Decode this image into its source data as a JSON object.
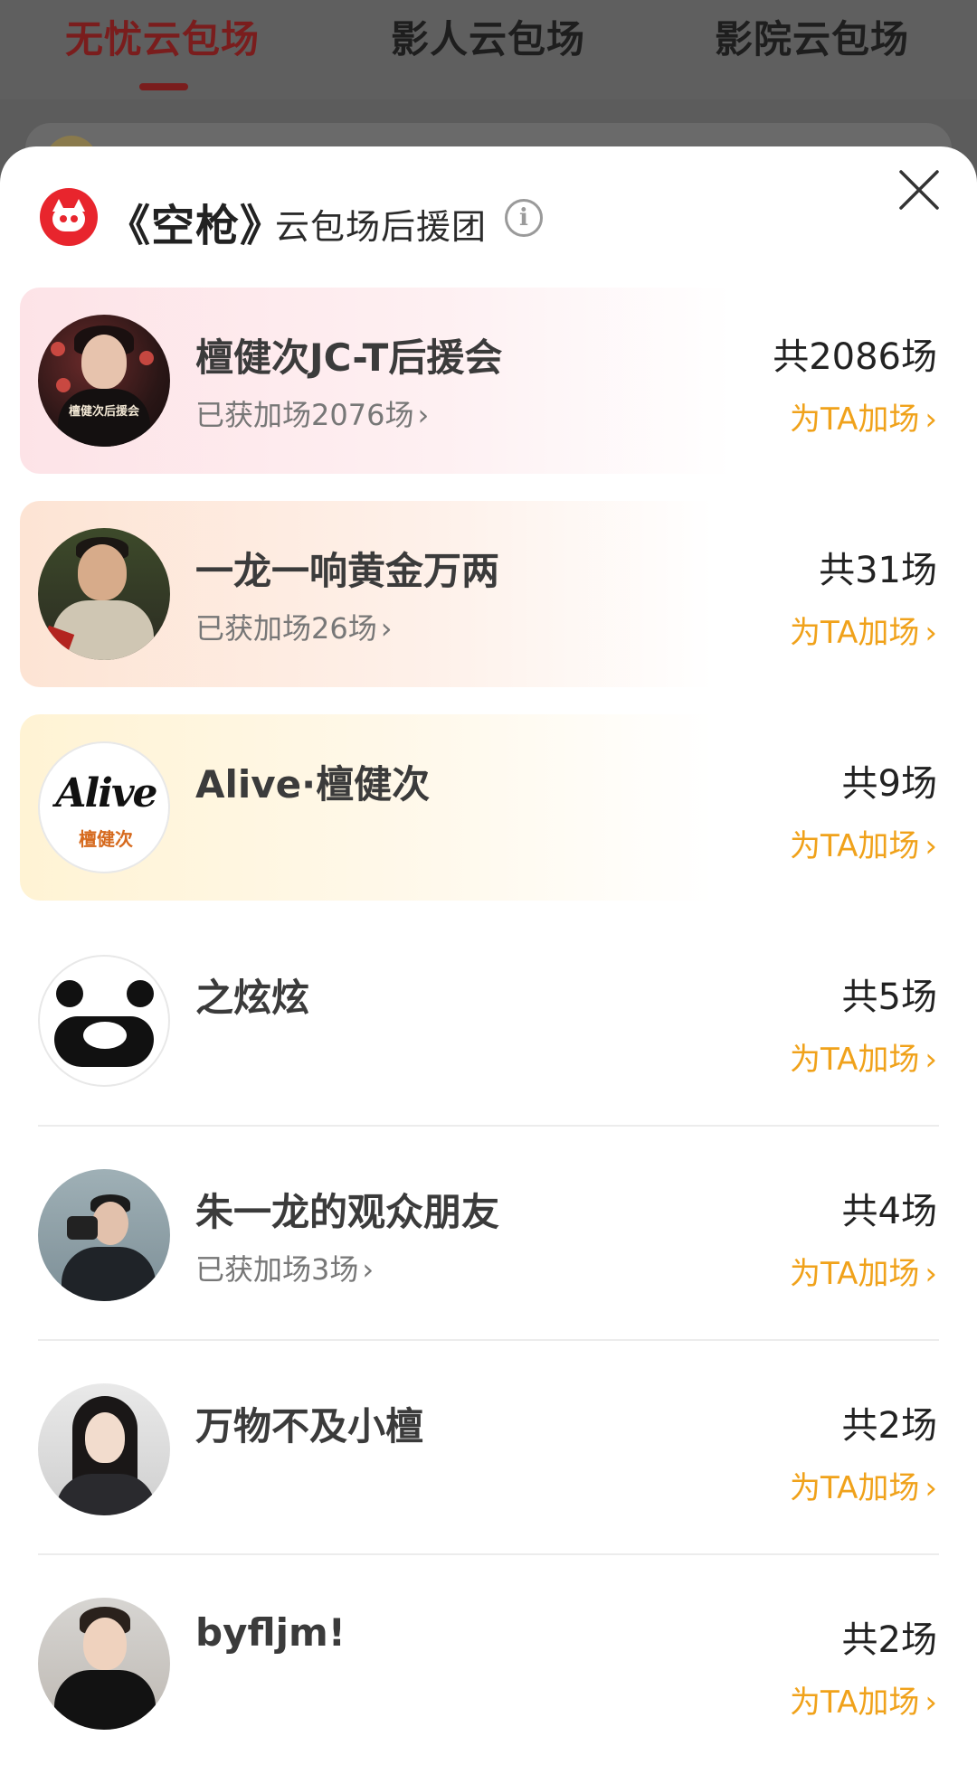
{
  "tabs": [
    {
      "label": "无忧云包场",
      "active": true
    },
    {
      "label": "影人云包场",
      "active": false
    },
    {
      "label": "影院云包场",
      "active": false
    }
  ],
  "sheet": {
    "movie_title": "《空枪》",
    "subtitle": "云包场后援团",
    "info_icon": "info-icon",
    "close_icon": "close-icon",
    "brand_icon": "cat-logo-icon"
  },
  "colors": {
    "brand_red": "#e8252d",
    "boost_orange": "#f0a21b"
  },
  "groups": [
    {
      "name": "檀健次JC-T后援会",
      "got": "已获加场2076场",
      "total": "共2086场",
      "boost": "为TA加场",
      "style": "pink",
      "avatar_caption": "檀健次后援会"
    },
    {
      "name": "一龙一响黄金万两",
      "got": "已获加场26场",
      "total": "共31场",
      "boost": "为TA加场",
      "style": "peach"
    },
    {
      "name": "Alive·檀健次",
      "got": "",
      "total": "共9场",
      "boost": "为TA加场",
      "style": "cream",
      "avatar_script": "Alive",
      "avatar_cn": "檀健次"
    },
    {
      "name": "之炫炫",
      "got": "",
      "total": "共5场",
      "boost": "为TA加场",
      "style": "plain"
    },
    {
      "name": "朱一龙的观众朋友",
      "got": "已获加场3场",
      "total": "共4场",
      "boost": "为TA加场",
      "style": "plain"
    },
    {
      "name": "万物不及小檀",
      "got": "",
      "total": "共2场",
      "boost": "为TA加场",
      "style": "plain"
    },
    {
      "name": "byfljm!",
      "got": "",
      "total": "共2场",
      "boost": "为TA加场",
      "style": "plain"
    }
  ]
}
